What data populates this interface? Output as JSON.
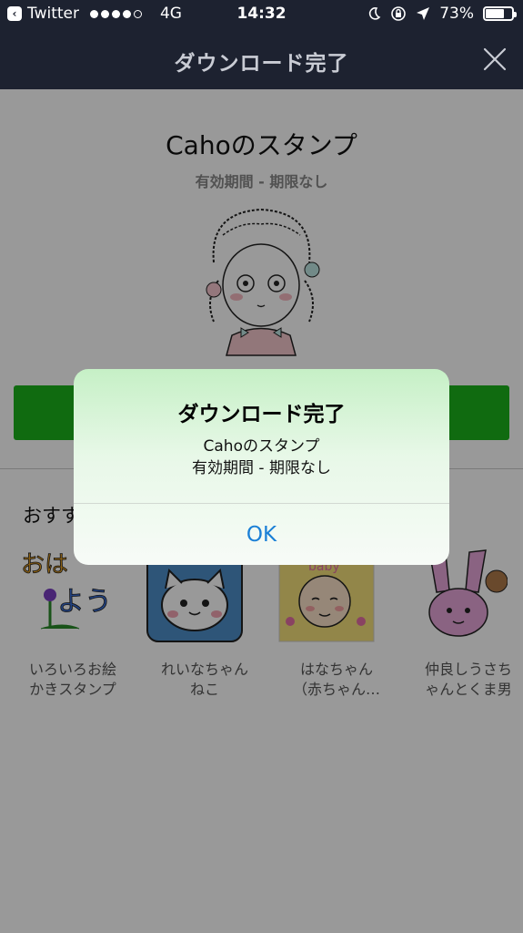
{
  "status_bar": {
    "carrier": "Twitter",
    "network": "4G",
    "time": "14:32",
    "battery": "73%",
    "battery_level": 0.73
  },
  "nav": {
    "title": "ダウンロード完了"
  },
  "sticker": {
    "title": "Cahoのスタンプ",
    "validity": "有効期間 - 期限なし"
  },
  "recommend": {
    "heading": "おすすめ",
    "items": [
      {
        "name": "いろいろお絵\nかきスタンプ"
      },
      {
        "name": "れいなちゃん\nねこ"
      },
      {
        "name": "はなちゃん\n（赤ちゃん…"
      },
      {
        "name": "仲良しうさち\nゃんとくま男"
      }
    ]
  },
  "alert": {
    "title": "ダウンロード完了",
    "message_line1": "Cahoのスタンプ",
    "message_line2": "有効期間 - 期限なし",
    "ok_label": "OK"
  },
  "colors": {
    "nav_bg": "#1d2230",
    "green": "#1bb31b",
    "link_blue": "#1a7fd6"
  }
}
